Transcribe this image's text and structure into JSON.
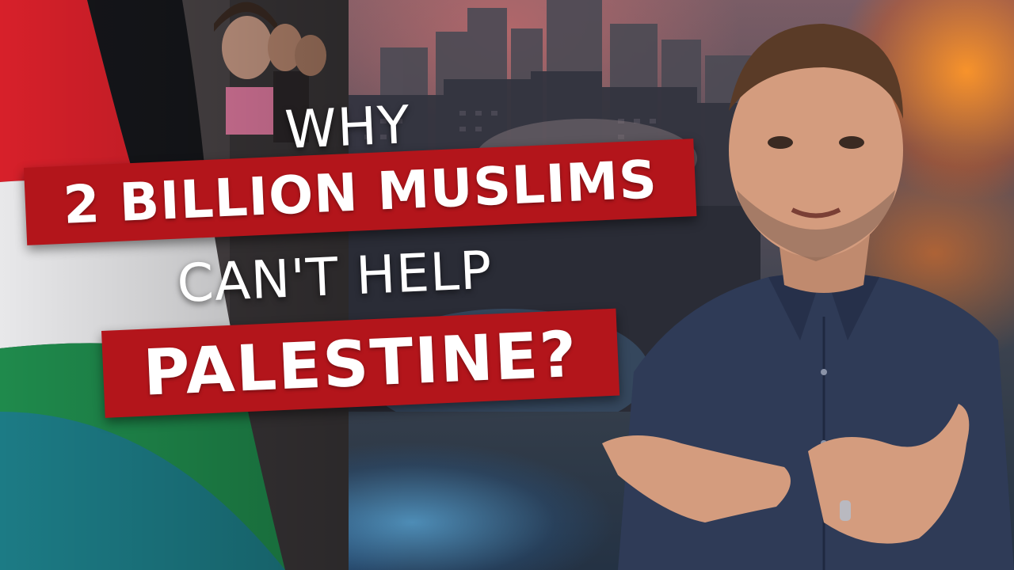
{
  "headline": {
    "line1": "WHY",
    "line2": "2 BILLION MUSLIMS",
    "line3": "CAN'T HELP",
    "line4": "PALESTINE?"
  },
  "colors": {
    "banner": "#b3151b",
    "text": "#ffffff",
    "flag_red": "#d7202a",
    "flag_black": "#15161a",
    "flag_white": "#e8e8ea",
    "flag_green": "#1f8a4c",
    "shirt": "#2f3b57",
    "fire": "#ff8a28"
  },
  "scene": {
    "left": "flag",
    "center": "city-skyline-with-smoke",
    "right": "presenter"
  }
}
